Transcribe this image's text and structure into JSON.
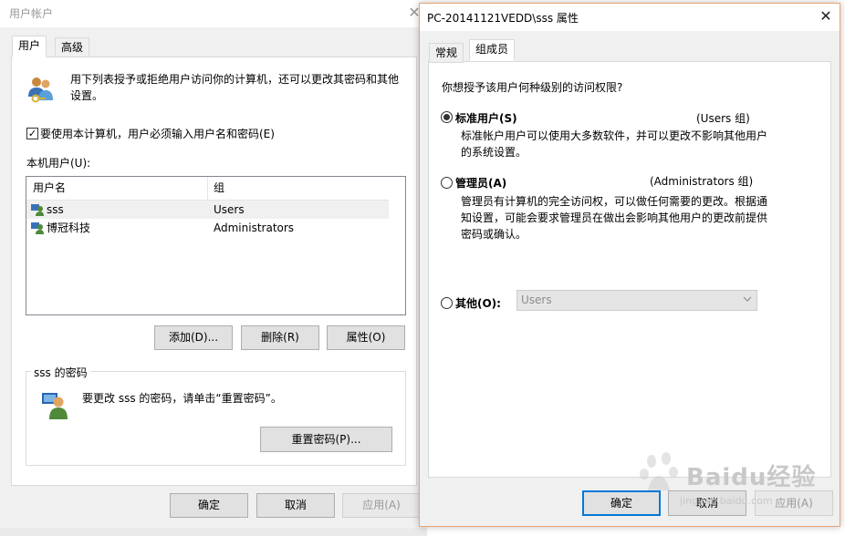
{
  "left_window": {
    "title": "用户帐户",
    "close_glyph": "✕",
    "tabs": [
      {
        "label": "用户"
      },
      {
        "label": "高级"
      }
    ],
    "intro_text": "用下列表授予或拒绝用户访问你的计算机，还可以更改其密码和其他设置。",
    "require_password": {
      "checked_glyph": "✓",
      "label": "要使用本计算机，用户必须输入用户名和密码(E)"
    },
    "local_users_label": "本机用户(U):",
    "columns": {
      "username": "用户名",
      "group": "组"
    },
    "users": [
      {
        "name": "sss",
        "group": "Users"
      },
      {
        "name": "博冠科技",
        "group": "Administrators"
      }
    ],
    "buttons": {
      "add": "添加(D)...",
      "remove": "删除(R)",
      "properties": "属性(O)"
    },
    "password_group": {
      "legend": "sss 的密码",
      "text": "要更改 sss 的密码，请单击“重置密码”。",
      "reset_button": "重置密码(P)..."
    },
    "footer": {
      "ok": "确定",
      "cancel": "取消",
      "apply": "应用(A)"
    }
  },
  "right_window": {
    "title": "PC-20141121VEDD\\sss 属性",
    "close_glyph": "✕",
    "tabs": [
      {
        "label": "常规"
      },
      {
        "label": "组成员"
      }
    ],
    "question": "你想授予该用户何种级别的访问权限?",
    "options": {
      "standard": {
        "label": "标准用户(S)",
        "group": "(Users 组)",
        "desc": "标准帐户用户可以使用大多数软件，并可以更改不影响其他用户的系统设置。",
        "selected": true
      },
      "admin": {
        "label": "管理员(A)",
        "group": "(Administrators 组)",
        "desc": "管理员有计算机的完全访问权，可以做任何需要的更改。根据通知设置，可能会要求管理员在做出会影响其他用户的更改前提供密码或确认。",
        "selected": false
      },
      "other": {
        "label": "其他(O):",
        "select_value": "Users",
        "selected": false
      }
    },
    "footer": {
      "ok": "确定",
      "cancel": "取消",
      "apply": "应用(A)"
    }
  },
  "watermark": {
    "text": "Baidu经验",
    "url": "jingyan.baidu.com"
  }
}
